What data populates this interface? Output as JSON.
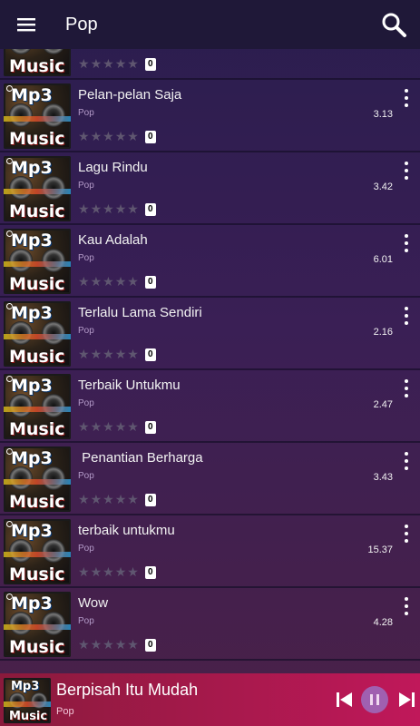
{
  "header": {
    "title": "Pop",
    "menu_icon": "menu-icon",
    "search_icon": "search-icon"
  },
  "songs": [
    {
      "title": "",
      "genre": "",
      "duration": "",
      "rating_count": "0"
    },
    {
      "title": "Pelan-pelan Saja",
      "genre": "Pop",
      "duration": "3.13",
      "rating_count": "0"
    },
    {
      "title": "Lagu Rindu",
      "genre": "Pop",
      "duration": "3.42",
      "rating_count": "0"
    },
    {
      "title": "Kau Adalah",
      "genre": "Pop",
      "duration": "6.01",
      "rating_count": "0"
    },
    {
      "title": "Terlalu Lama Sendiri",
      "genre": "Pop",
      "duration": "2.16",
      "rating_count": "0"
    },
    {
      "title": "Terbaik Untukmu",
      "genre": "Pop",
      "duration": "2.47",
      "rating_count": "0"
    },
    {
      "title": " Penantian Berharga",
      "genre": "Pop",
      "duration": "3.43",
      "rating_count": "0"
    },
    {
      "title": "terbaik untukmu",
      "genre": "Pop",
      "duration": "15.37",
      "rating_count": "0"
    },
    {
      "title": "Wow",
      "genre": "Pop",
      "duration": "4.28",
      "rating_count": "0"
    }
  ],
  "artwork": {
    "line1": "Mp3",
    "line2": "Music"
  },
  "now_playing": {
    "title": "Berpisah Itu Mudah",
    "genre": "Pop"
  },
  "colors": {
    "topbar": "#1f1838",
    "player": "#c0185a",
    "pause_button": "#a060b0"
  }
}
